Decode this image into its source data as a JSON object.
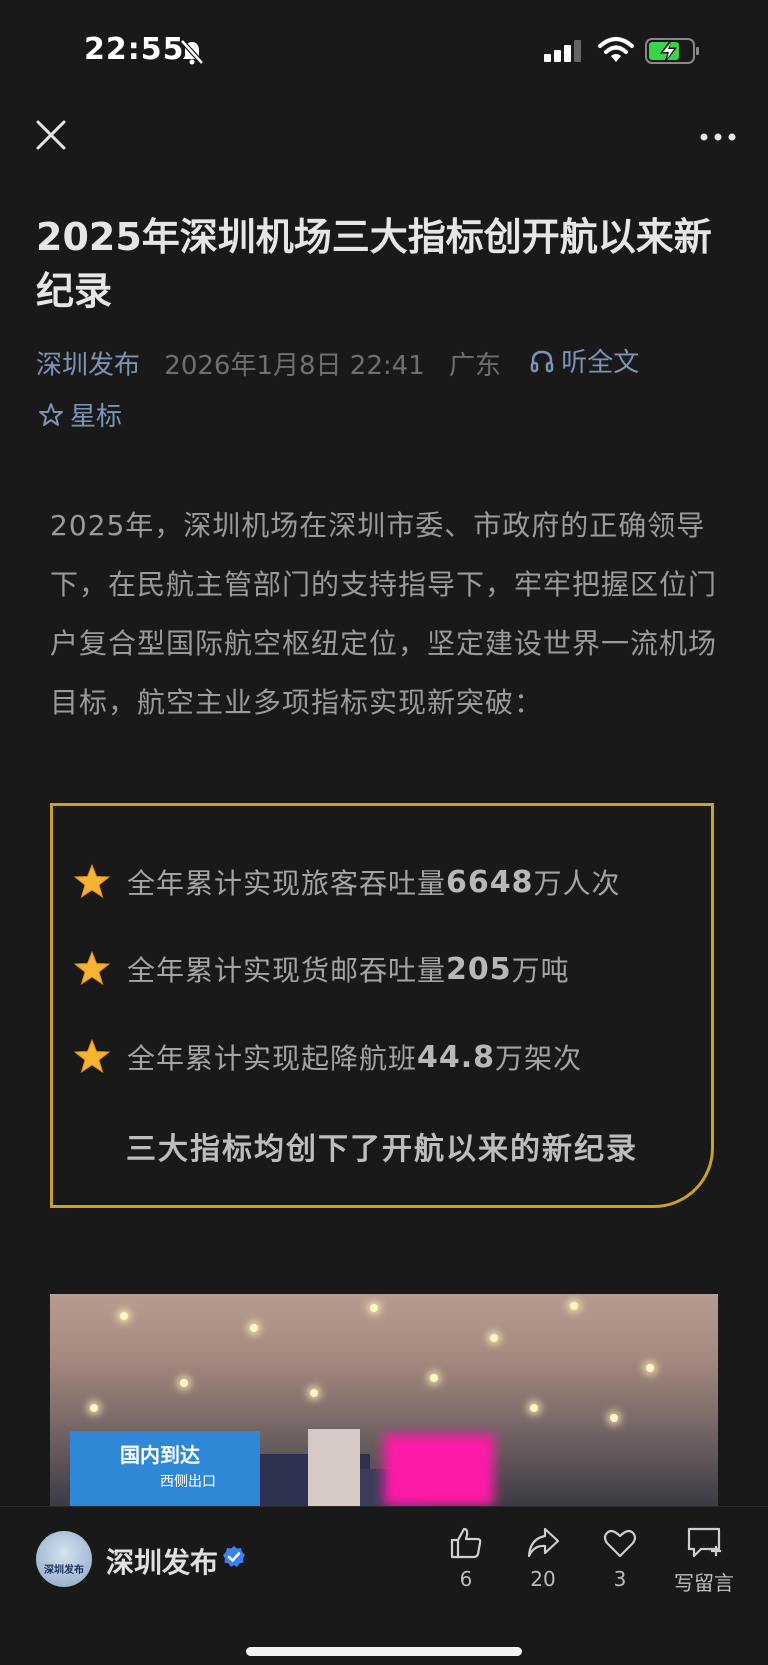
{
  "status_bar": {
    "time": "22:55",
    "icons": [
      "bell-off-icon",
      "signal-icon",
      "wifi-icon",
      "battery-charging-icon"
    ]
  },
  "nav": {
    "close_icon": "close-icon",
    "more_icon": "more-icon"
  },
  "article": {
    "title": "2025年深圳机场三大指标创开航以来新纪录",
    "account": "深圳发布",
    "date": "2026年1月8日 22:41",
    "region": "广东",
    "listen_label": "听全文",
    "star_label": "星标",
    "intro": "2025年，深圳机场在深圳市委、市政府的正确领导下，在民航主管部门的支持指导下，牢牢把握区位门户复合型国际航空枢纽定位，坚定建设世界一流机场目标，航空主业多项指标实现新突破："
  },
  "highlights": {
    "items": [
      {
        "prefix": "全年累计实现旅客吞吐量",
        "value": "6648",
        "suffix": "万人次"
      },
      {
        "prefix": "全年累计实现货邮吞吐量",
        "value": "205",
        "suffix": "万吨"
      },
      {
        "prefix": "全年累计实现起降航班",
        "value": "44.8",
        "suffix": "万架次"
      }
    ],
    "footer": "三大指标均创下了开航以来的新纪录"
  },
  "photo": {
    "sign_text": "国内到达",
    "sign_sub": "西侧出口"
  },
  "bottom_bar": {
    "account_name": "深圳发布",
    "avatar_text": "深圳发布",
    "likes": "6",
    "shares": "20",
    "favorites": "3",
    "comment_label": "写留言"
  },
  "colors": {
    "background": "#191919",
    "accent_link": "#7d93b5",
    "box_border": "#c9a227",
    "verified": "#3c82f0"
  }
}
